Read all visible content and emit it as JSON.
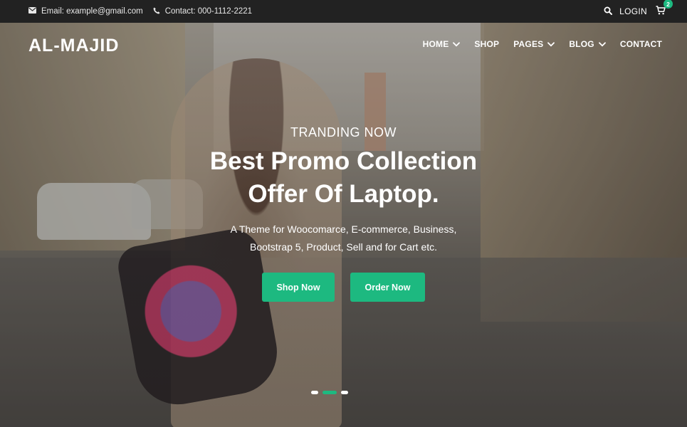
{
  "topbar": {
    "email": "Email: example@gmail.com",
    "contact": "Contact: 000-1112-2221",
    "login": "LOGIN",
    "cart_count": "2",
    "icons": {
      "email": "envelope-icon",
      "phone": "phone-icon",
      "search": "search-icon",
      "cart": "cart-icon"
    }
  },
  "brand": {
    "logo": "AL-MAJID"
  },
  "nav": {
    "items": [
      {
        "label": "HOME",
        "has_dropdown": true
      },
      {
        "label": "SHOP",
        "has_dropdown": false
      },
      {
        "label": "PAGES",
        "has_dropdown": true
      },
      {
        "label": "BLOG",
        "has_dropdown": true
      },
      {
        "label": "CONTACT",
        "has_dropdown": false
      }
    ]
  },
  "hero": {
    "eyebrow": "TRANDING NOW",
    "headline_line1": "Best Promo Collection",
    "headline_line2": "Offer Of Laptop.",
    "desc_line1": "A Theme for Woocomarce, E-commerce, Business,",
    "desc_line2": "Bootstrap 5, Product, Sell and for Cart etc.",
    "buttons": {
      "shop": "Shop Now",
      "order": "Order Now"
    },
    "slides": {
      "count": 3,
      "active_index": 1
    }
  },
  "colors": {
    "accent": "#1db980",
    "topbar_bg": "#222222",
    "text": "#ffffff"
  }
}
